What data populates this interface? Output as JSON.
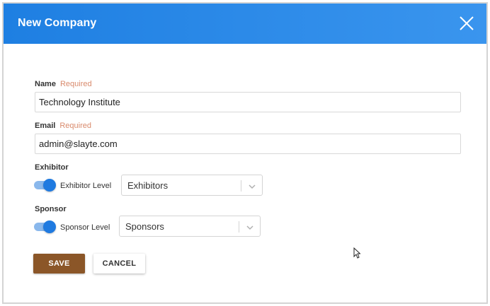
{
  "dialog": {
    "title": "New Company",
    "close_icon": "close-icon"
  },
  "form": {
    "name": {
      "label": "Name",
      "required": "Required",
      "value": "Technology Institute"
    },
    "email": {
      "label": "Email",
      "required": "Required",
      "value": "admin@slayte.com"
    },
    "exhibitor": {
      "label": "Exhibitor",
      "toggle_label": "Exhibitor Level",
      "toggle_on": true,
      "select_value": "Exhibitors"
    },
    "sponsor": {
      "label": "Sponsor",
      "toggle_label": "Sponsor Level",
      "toggle_on": true,
      "select_value": "Sponsors"
    }
  },
  "actions": {
    "save_label": "SAVE",
    "cancel_label": "CANCEL"
  },
  "colors": {
    "header": "#2a88e8",
    "save_button": "#8b5628",
    "toggle_on": "#1f7ae0",
    "required_text": "#d98a6c"
  }
}
